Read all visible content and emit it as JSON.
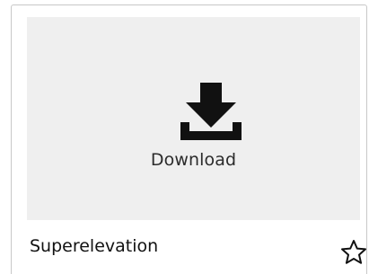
{
  "card": {
    "preview": {
      "download_label": "Download",
      "icon": "download-icon"
    },
    "title": "Superelevation",
    "favorite_icon": "star-outline-icon"
  },
  "colors": {
    "preview_background": "#efefef",
    "icon": "#111111",
    "border": "#c8c8c8"
  }
}
